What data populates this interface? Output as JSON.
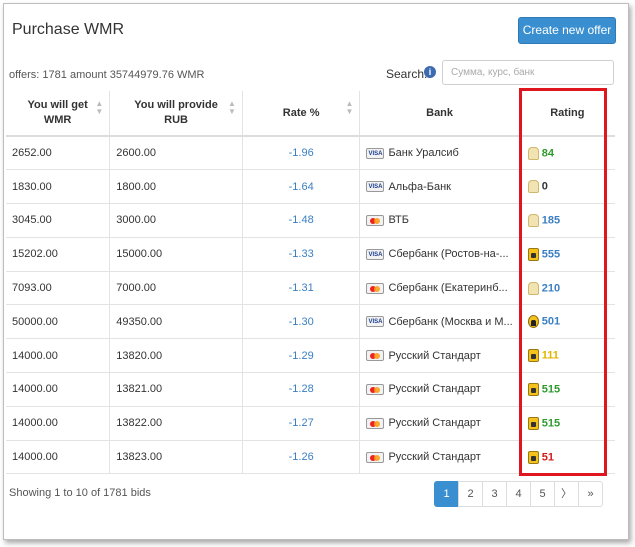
{
  "panel": {
    "title": "Purchase WMR",
    "create_button": "Create new offer",
    "summary": "offers: 1781 amount 35744979.76 WMR"
  },
  "search": {
    "label": "Search:",
    "placeholder": "Сумма, курс, банк",
    "info_icon": "info-icon"
  },
  "table": {
    "headers": [
      {
        "line1": "You will get",
        "line2": "WMR"
      },
      {
        "line1": "You will provide",
        "line2": "RUB"
      },
      {
        "line1": "Rate %",
        "line2": ""
      },
      {
        "line1": "Bank",
        "line2": ""
      },
      {
        "line1": "Rating",
        "line2": ""
      }
    ],
    "rows": [
      {
        "get": "2652.00",
        "provide": "2600.00",
        "rate": "-1.96",
        "card": "visa",
        "bank": "Банк Уралсиб",
        "badge": "pale",
        "rating": "84",
        "rating_color": "#2e9a2e"
      },
      {
        "get": "1830.00",
        "provide": "1800.00",
        "rate": "-1.64",
        "card": "visa",
        "bank": "Альфа-Банк",
        "badge": "pale",
        "rating": "0",
        "rating_color": "#333333"
      },
      {
        "get": "3045.00",
        "provide": "3000.00",
        "rate": "-1.48",
        "card": "mc",
        "bank": "ВТБ",
        "badge": "pale",
        "rating": "185",
        "rating_color": "#3a7fc2"
      },
      {
        "get": "15202.00",
        "provide": "15000.00",
        "rate": "-1.33",
        "card": "visa",
        "bank": "Сбербанк (Ростов-на-...",
        "badge": "gold",
        "rating": "555",
        "rating_color": "#3a7fc2"
      },
      {
        "get": "7093.00",
        "provide": "7000.00",
        "rate": "-1.31",
        "card": "mc",
        "bank": "Сбербанк (Екатеринб...",
        "badge": "pale",
        "rating": "210",
        "rating_color": "#3a7fc2"
      },
      {
        "get": "50000.00",
        "provide": "49350.00",
        "rate": "-1.30",
        "card": "visa",
        "bank": "Сбербанк (Москва и М...",
        "badge": "person",
        "rating": "501",
        "rating_color": "#3a7fc2"
      },
      {
        "get": "14000.00",
        "provide": "13820.00",
        "rate": "-1.29",
        "card": "mc",
        "bank": "Русский Стандарт",
        "badge": "gold",
        "rating": "111",
        "rating_color": "#e0b400"
      },
      {
        "get": "14000.00",
        "provide": "13821.00",
        "rate": "-1.28",
        "card": "mc",
        "bank": "Русский Стандарт",
        "badge": "gold",
        "rating": "515",
        "rating_color": "#2e9a2e"
      },
      {
        "get": "14000.00",
        "provide": "13822.00",
        "rate": "-1.27",
        "card": "mc",
        "bank": "Русский Стандарт",
        "badge": "gold",
        "rating": "515",
        "rating_color": "#2e9a2e"
      },
      {
        "get": "14000.00",
        "provide": "13823.00",
        "rate": "-1.26",
        "card": "mc",
        "bank": "Русский Стандарт",
        "badge": "gold",
        "rating": "51",
        "rating_color": "#d21a1a"
      }
    ]
  },
  "footer": {
    "showing": "Showing 1 to 10 of 1781 bids",
    "pages": [
      "1",
      "2",
      "3",
      "4",
      "5",
      "〉",
      "»"
    ],
    "active_page": "1"
  },
  "colors": {
    "accent": "#3a8fd0",
    "highlight_box": "#e0161e",
    "rate_text": "#3a7fc2"
  }
}
